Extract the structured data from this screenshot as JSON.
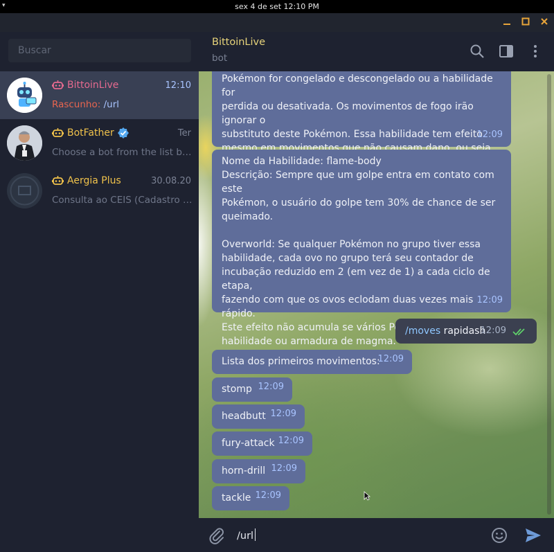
{
  "system": {
    "clock": "sex 4 de set  12:10 PM"
  },
  "window": {
    "controls": [
      "minimize",
      "maximize",
      "close"
    ]
  },
  "sidebar": {
    "search_placeholder": "Buscar",
    "chats": [
      {
        "title": "BittoinLive",
        "time": "12:10",
        "preview_prefix": "Rascunho:",
        "preview_text": "/url",
        "title_color": "#e66a8f",
        "active": true
      },
      {
        "title": "BotFather",
        "time": "Ter",
        "preview": "Choose a bot from the list below:",
        "title_color": "#f0c24b",
        "verified": true
      },
      {
        "title": "Aergia Plus",
        "time": "30.08.20",
        "preview": "Consulta ao CEIS (Cadastro Nacional",
        "title_color": "#f0c24b"
      }
    ]
  },
  "header": {
    "name": "BittoinLive",
    "status": "bot"
  },
  "messages": [
    {
      "text": "Pokémon for congelado e descongelado ou a habilidade for\nperdida ou desativada. Os movimentos de fogo irão ignorar o\nsubstituto deste Pokémon. Essa habilidade tem efeito\nmesmo em movimentos que não causam dano, ou seja, vão\npiscar.",
      "time": "12:09"
    },
    {
      "text": "Nome da Habilidade: flame-body\nDescrição: Sempre que um golpe entra em contato com este\nPokémon, o usuário do golpe tem 30% de chance de ser\nqueimado.\n\nOverworld: Se qualquer Pokémon no grupo tiver essa\nhabilidade, cada ovo no grupo terá seu contador de\nincubação reduzido em 2 (em vez de 1) a cada ciclo de etapa,\nfazendo com que os ovos eclodam duas vezes mais rápido.\nEste efeito não acumula se vários Pokémon tiverem essa\nhabilidade ou armadura de magma.",
      "time": "12:09"
    },
    {
      "cmd": "/moves",
      "text": " rapidash",
      "time": "12:09",
      "outgoing": true
    },
    {
      "text": "Lista dos primeiros movimentos:",
      "time": "12:09"
    },
    {
      "text": "stomp",
      "time": "12:09"
    },
    {
      "text": "headbutt",
      "time": "12:09"
    },
    {
      "text": "fury-attack",
      "time": "12:09"
    },
    {
      "text": "horn-drill",
      "time": "12:09"
    },
    {
      "text": "tackle",
      "time": "12:09"
    }
  ],
  "compose": {
    "value": "/url"
  }
}
